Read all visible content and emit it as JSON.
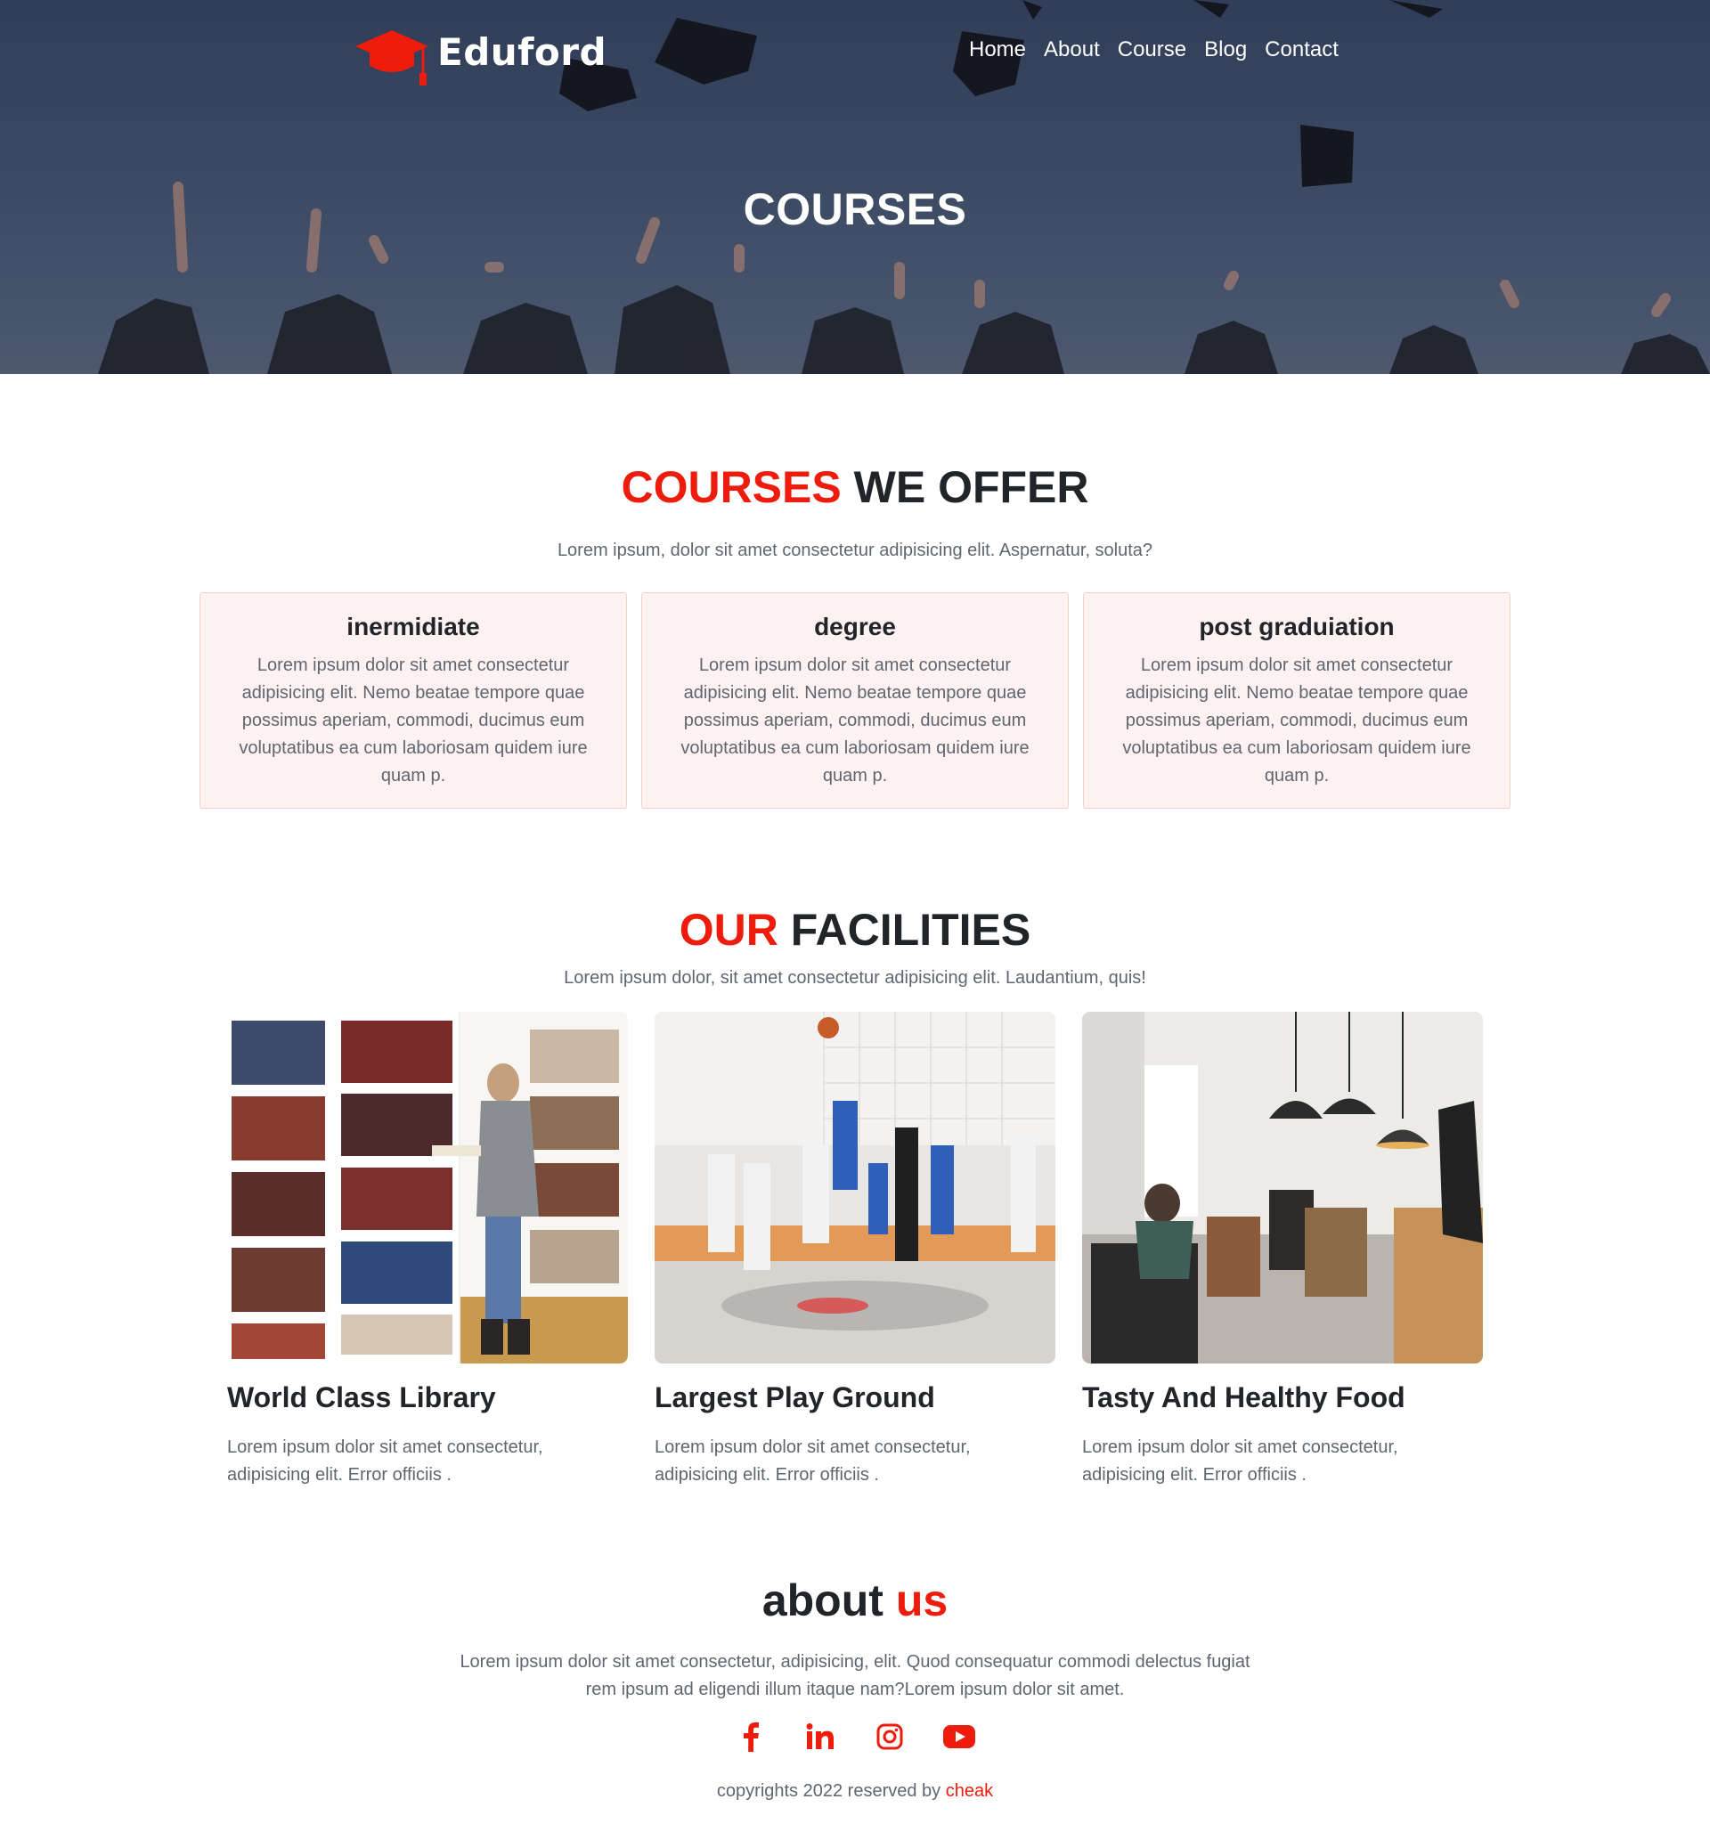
{
  "brand": {
    "name": "Eduford",
    "logo_icon": "graduation-cap-icon"
  },
  "nav": [
    {
      "label": "Home"
    },
    {
      "label": "About"
    },
    {
      "label": "Course"
    },
    {
      "label": "Blog"
    },
    {
      "label": "Contact"
    }
  ],
  "hero": {
    "title": "COURSES"
  },
  "courses_section": {
    "title_red": "COURSES",
    "title_dark": "WE OFFER",
    "subtitle": "Lorem ipsum, dolor sit amet consectetur adipisicing elit. Aspernatur, soluta?",
    "cards": [
      {
        "title": "inermidiate",
        "text": "Lorem ipsum dolor sit amet consectetur adipisicing elit. Nemo beatae tempore quae possimus aperiam, commodi, ducimus eum voluptatibus ea cum laboriosam quidem iure quam p."
      },
      {
        "title": "degree",
        "text": "Lorem ipsum dolor sit amet consectetur adipisicing elit. Nemo beatae tempore quae possimus aperiam, commodi, ducimus eum voluptatibus ea cum laboriosam quidem iure quam p."
      },
      {
        "title": "post graduiation",
        "text": "Lorem ipsum dolor sit amet consectetur adipisicing elit. Nemo beatae tempore quae possimus aperiam, commodi, ducimus eum voluptatibus ea cum laboriosam quidem iure quam p."
      }
    ]
  },
  "facilities_section": {
    "title_red": "OUR",
    "title_dark": "FACILITIES",
    "subtitle": "Lorem ipsum dolor, sit amet consectetur adipisicing elit. Laudantium, quis!",
    "items": [
      {
        "title": "World Class Library",
        "text": "Lorem ipsum dolor sit amet consectetur, adipisicing elit. Error officiis ."
      },
      {
        "title": "Largest Play Ground",
        "text": "Lorem ipsum dolor sit amet consectetur, adipisicing elit. Error officiis ."
      },
      {
        "title": "Tasty And Healthy Food",
        "text": "Lorem ipsum dolor sit amet consectetur, adipisicing elit. Error officiis ."
      }
    ]
  },
  "about_section": {
    "title_dark": "about",
    "title_red": "us",
    "text": "Lorem ipsum dolor sit amet consectetur, adipisicing, elit. Quod consequatur commodi delectus fugiat rem ipsum ad eligendi illum itaque nam?Lorem ipsum dolor sit amet.",
    "social": [
      "facebook-icon",
      "linkedin-icon",
      "instagram-icon",
      "youtube-icon"
    ]
  },
  "footer": {
    "copyright_prefix": "copyrights 2022 reserved by ",
    "copyright_link": "cheak"
  },
  "colors": {
    "accent": "#ed1c0c",
    "card_bg": "#fdf2f1",
    "text": "#212529",
    "muted": "#5f6670"
  }
}
